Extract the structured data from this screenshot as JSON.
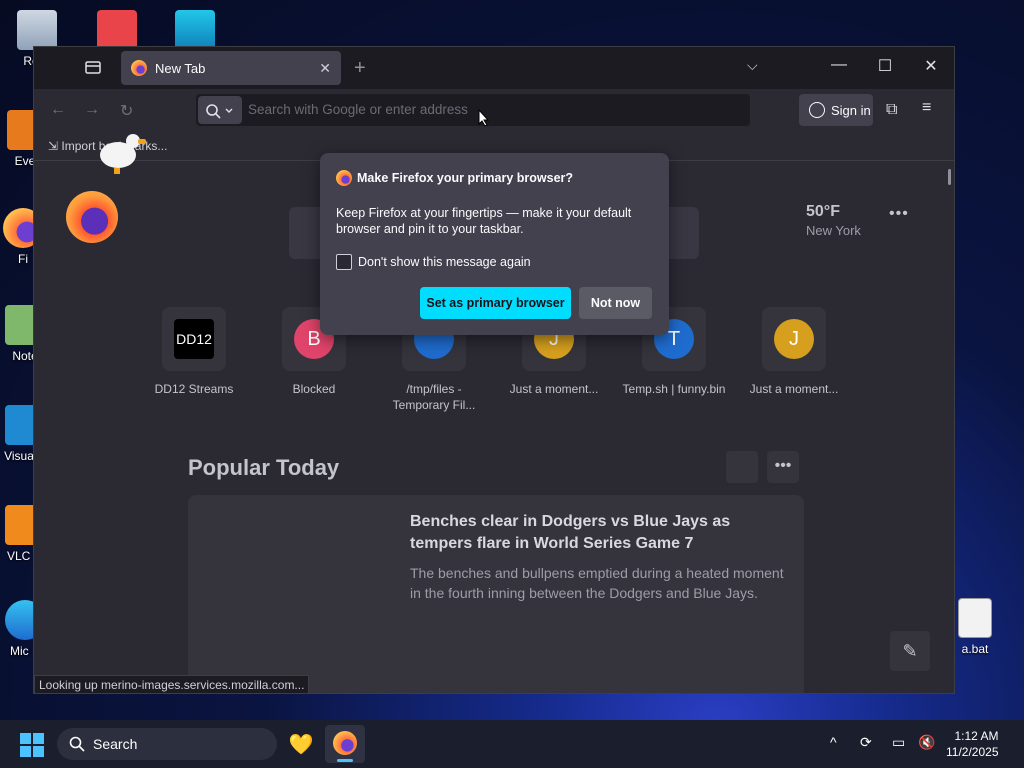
{
  "desktop": {
    "icons": [
      {
        "label": "Recy"
      },
      {
        "label": "Ever"
      },
      {
        "label": "Fi"
      },
      {
        "label": "Note"
      },
      {
        "label": "Visua C"
      },
      {
        "label": "VLC pl"
      },
      {
        "label": "Mic E"
      },
      {
        "label": "a.bat"
      }
    ]
  },
  "browser": {
    "tab_title": "New Tab",
    "url_placeholder": "Search with Google or enter address",
    "signin_label": "Sign in",
    "bookmark_import": "Import bookmarks...",
    "weather": {
      "temp": "50°F",
      "location": "New York"
    },
    "top_sites": [
      {
        "label": "DD12 Streams",
        "tile_text": "DD12"
      },
      {
        "label": "Blocked",
        "tile_text": "B",
        "color": "#e0446a"
      },
      {
        "label": "/tmp/files - Temporary Fil...",
        "tile_text": "",
        "color": "#1f6ccf"
      },
      {
        "label": "Just a moment...",
        "tile_text": "J",
        "color": "#d6a01e"
      },
      {
        "label": "Temp.sh | funny.bin",
        "tile_text": "T",
        "color": "#1f6ccf"
      },
      {
        "label": "Just a moment...",
        "tile_text": "J",
        "color": "#d6a01e"
      }
    ],
    "popular_title": "Popular Today",
    "article": {
      "headline": "Benches clear in Dodgers vs Blue Jays as tempers flare in World Series Game 7",
      "excerpt": "The benches and bullpens emptied during a heated moment in the fourth inning between the Dodgers and Blue Jays."
    },
    "status_text": "Looking up merino-images.services.mozilla.com..."
  },
  "dialog": {
    "title": "Make Firefox your primary browser?",
    "body": "Keep Firefox at your fingertips — make it your default browser and pin it to your taskbar.",
    "checkbox_label": "Don't show this message again",
    "primary_button": "Set as primary browser",
    "secondary_button": "Not now"
  },
  "taskbar": {
    "search_label": "Search",
    "time": "1:12 AM",
    "date": "11/2/2025"
  },
  "colors": {
    "accent": "#00ddff",
    "windows_blue": "#4cc2ff"
  }
}
